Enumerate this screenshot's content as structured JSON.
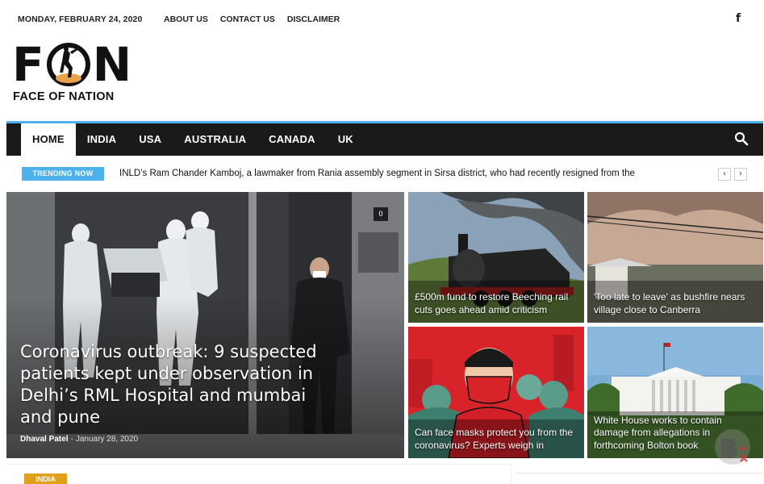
{
  "topbar": {
    "date": "MONDAY, FEBRUARY 24, 2020",
    "links": [
      "ABOUT US",
      "CONTACT US",
      "DISCLAIMER"
    ],
    "social_icon": "facebook-icon",
    "social_glyph": "f"
  },
  "logo": {
    "letter_left": "F",
    "letter_right": "N",
    "subtitle": "FACE OF NATION"
  },
  "nav": {
    "items": [
      "HOME",
      "INDIA",
      "USA",
      "AUSTRALIA",
      "CANADA",
      "UK"
    ],
    "active": "HOME",
    "search_icon": "search-icon"
  },
  "trending": {
    "label": "TRENDING NOW",
    "text": "INLD’s Ram Chander Kamboj, a lawmaker from Rania assembly segment in Sirsa district, who had recently resigned from the",
    "prev": "‹",
    "next": "›"
  },
  "featured": {
    "title": "Coronavirus outbreak: 9 suspected patients kept under observation in Delhi’s RML Hospital and mumbai and pune",
    "author": "Dhaval Patel",
    "separator": "-",
    "date": "January 28, 2020",
    "comments": "0"
  },
  "tiles": [
    {
      "title": "£500m fund to restore Beeching rail cuts goes ahead amid criticism"
    },
    {
      "title": "'Too late to leave' as bushfire nears village close to Canberra"
    },
    {
      "title": "Can face masks protect you from the coronavirus? Experts weigh in"
    },
    {
      "title": "White House works to contain damage from allegations in forthcoming Bolton book"
    }
  ],
  "bottom": {
    "category": "INDIA"
  },
  "colors": {
    "accent": "#4db2ec",
    "nav_bg": "#1a1a1a",
    "category_badge": "#e0a01b"
  }
}
